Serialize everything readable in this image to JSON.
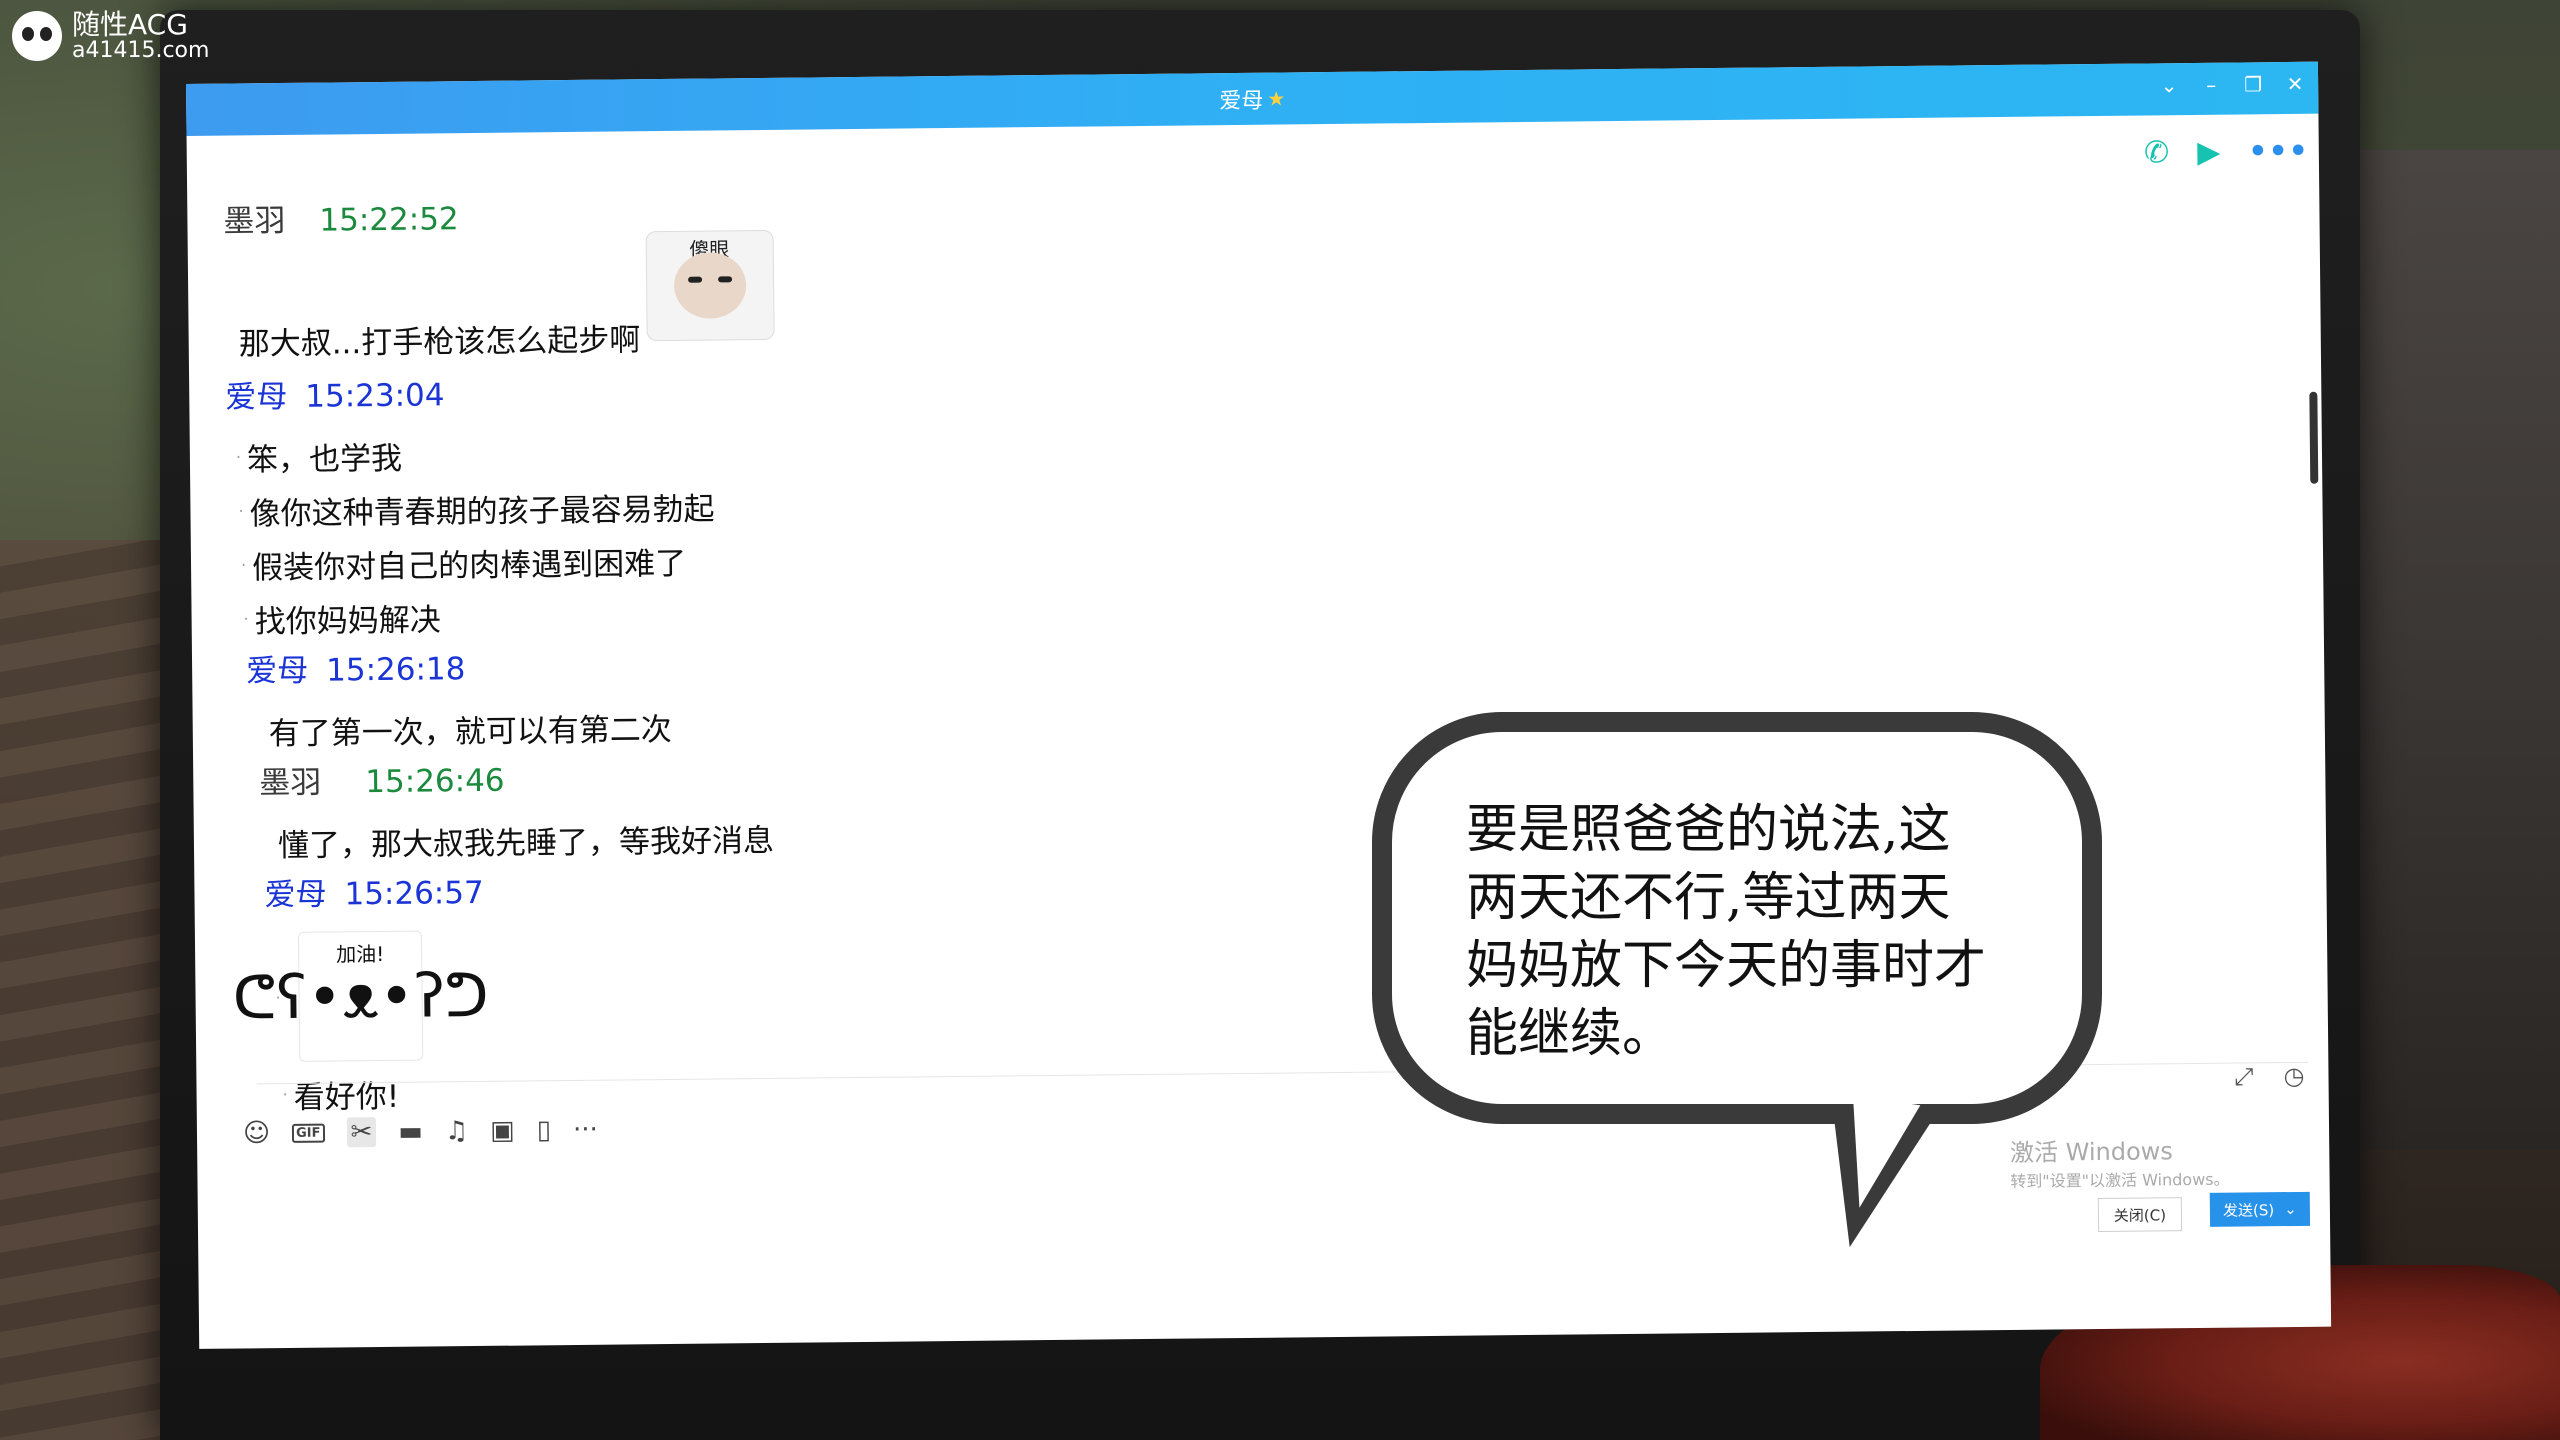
{
  "watermark": {
    "title": "随性ACG",
    "url": "a41415.com"
  },
  "window": {
    "title": "爱母",
    "title_icon": "star-icon"
  },
  "top_actions": [
    "phone-icon",
    "video-call-icon",
    "more-icon"
  ],
  "messages": [
    {
      "sender": "墨羽",
      "time": "15:22:52",
      "role": "self",
      "lines": [
        {
          "text": "那大叔...打手枪该怎么起步啊",
          "sticker": "傻眼"
        }
      ]
    },
    {
      "sender": "爱母",
      "time": "15:23:04",
      "role": "other",
      "lines": [
        {
          "text": "笨，也学我"
        },
        {
          "text": "像你这种青春期的孩子最容易勃起"
        },
        {
          "text": "假装你对自己的肉棒遇到困难了"
        },
        {
          "text": "找你妈妈解决"
        }
      ]
    },
    {
      "sender": "爱母",
      "time": "15:26:18",
      "role": "other",
      "lines": [
        {
          "text": "有了第一次，就可以有第二次"
        }
      ]
    },
    {
      "sender": "墨羽",
      "time": "15:26:46",
      "role": "self",
      "lines": [
        {
          "text": "懂了，那大叔我先睡了，等我好消息"
        }
      ]
    },
    {
      "sender": "爱母",
      "time": "15:26:57",
      "role": "other",
      "sticker": "加油!",
      "lines": [
        {
          "text": "看好你!"
        }
      ]
    }
  ],
  "toolbar": {
    "gif_label": "GIF",
    "icons": [
      "emoji-icon",
      "gif-icon",
      "scissors-icon",
      "folder-icon",
      "music-icon",
      "image-icon",
      "shake-icon",
      "more-icon"
    ]
  },
  "activation": {
    "title": "激活 Windows",
    "subtitle": "转到\"设置\"以激活 Windows。"
  },
  "buttons": {
    "close": "关闭(C)",
    "send": "发送(S)"
  },
  "bubble": {
    "lines": [
      "要是照爸爸的说法,这",
      "两天还不行,等过两天",
      "妈妈放下今天的事时才",
      "能继续。"
    ]
  },
  "colors": {
    "title_bar": "#3d9bf0",
    "self_time": "#1c8a3d",
    "other_name": "#1a34d6",
    "send_button": "#2792ea"
  }
}
